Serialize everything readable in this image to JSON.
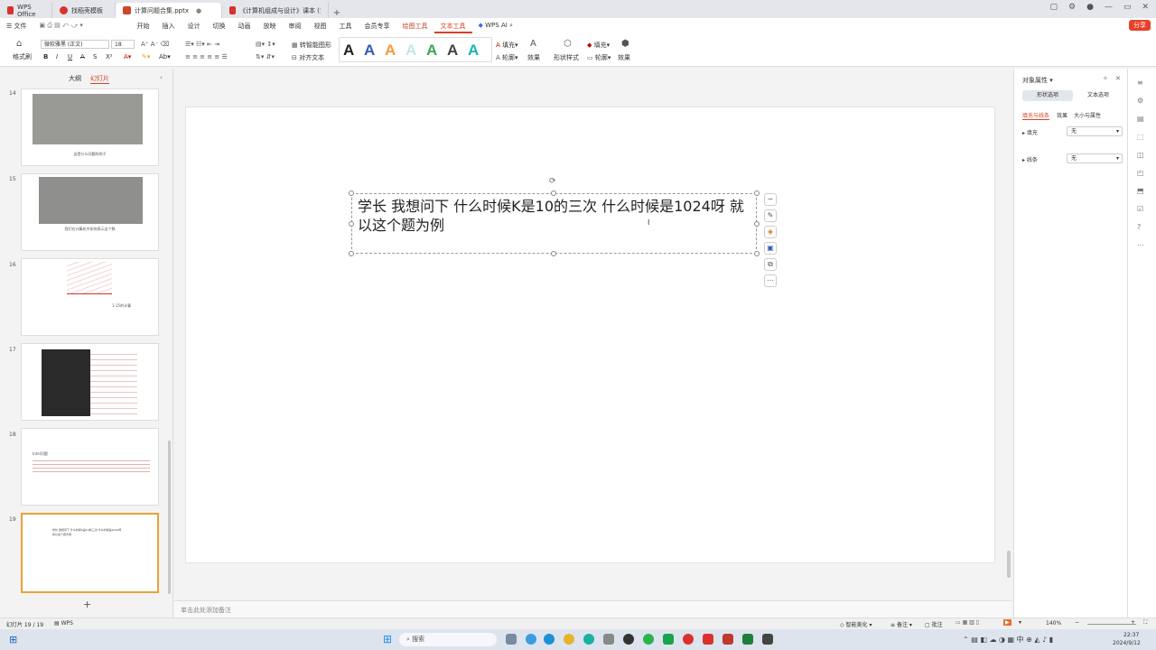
{
  "tabs": [
    {
      "label": "WPS Office",
      "color": "#d9312e"
    },
    {
      "label": "找稻壳模板",
      "color": "#d9312e"
    },
    {
      "label": "计算问题合集.pptx",
      "color": "#d14424"
    },
    {
      "label": "《计算机组成与设计》课本 (第五版...",
      "color": "#d9312e"
    }
  ],
  "menu": {
    "file": "文件",
    "items": [
      "开始",
      "插入",
      "设计",
      "切换",
      "动画",
      "放映",
      "审阅",
      "视图",
      "工具",
      "会员专享"
    ],
    "drawing_tools": "绘图工具",
    "text_tools": "文本工具",
    "wps_ai": "WPS AI",
    "share": "分享"
  },
  "ribbon": {
    "format_painter": "格式刷",
    "font_name": "微软雅黑 (正文)",
    "font_size": "18",
    "smart_layout": "转智能图形",
    "align_text": "对齐文本",
    "fill": "填充",
    "outline": "轮廓",
    "effects": "效果",
    "shape_style": "形状样式",
    "shape_fill": "填充",
    "shape_outline": "轮廓",
    "shape_effects": "效果"
  },
  "left_panel": {
    "outline_tab": "大纲",
    "slides_tab": "幻灯片"
  },
  "slides": [
    {
      "num": "14",
      "caption": "这是什么问题的例子"
    },
    {
      "num": "15",
      "caption": "我们在计算机中如何表示这个数"
    },
    {
      "num": "16",
      "caption": "1-15的计算"
    },
    {
      "num": "17",
      "caption": ""
    },
    {
      "num": "18",
      "caption": "Intel问题"
    },
    {
      "num": "19",
      "caption": "学长 我想问下 什么时候K是10的三次 什么时候是1024呀 就以这个题为例"
    }
  ],
  "main_text": "学长 我想问下 什么时候K是10的三次 什么时候是1024呀 就以这个题为例",
  "notes_placeholder": "单击此处添加备注",
  "right_panel": {
    "title": "对象属性",
    "tab_shape": "形状选项",
    "tab_text": "文本选项",
    "sub_fill": "填充与线条",
    "sub_effect": "效果",
    "sub_size": "大小与属性",
    "fill_label": "填充",
    "fill_value": "无",
    "line_label": "线条",
    "line_value": "无"
  },
  "status": {
    "slide_count": "幻灯片 19 / 19",
    "theme": "WPS",
    "smart_beautify": "智能美化",
    "notes": "备注",
    "comments": "批注",
    "zoom": "140%"
  },
  "taskbar": {
    "search": "搜索",
    "time": "22:37",
    "date": "2024/9/12",
    "lang": "中"
  }
}
